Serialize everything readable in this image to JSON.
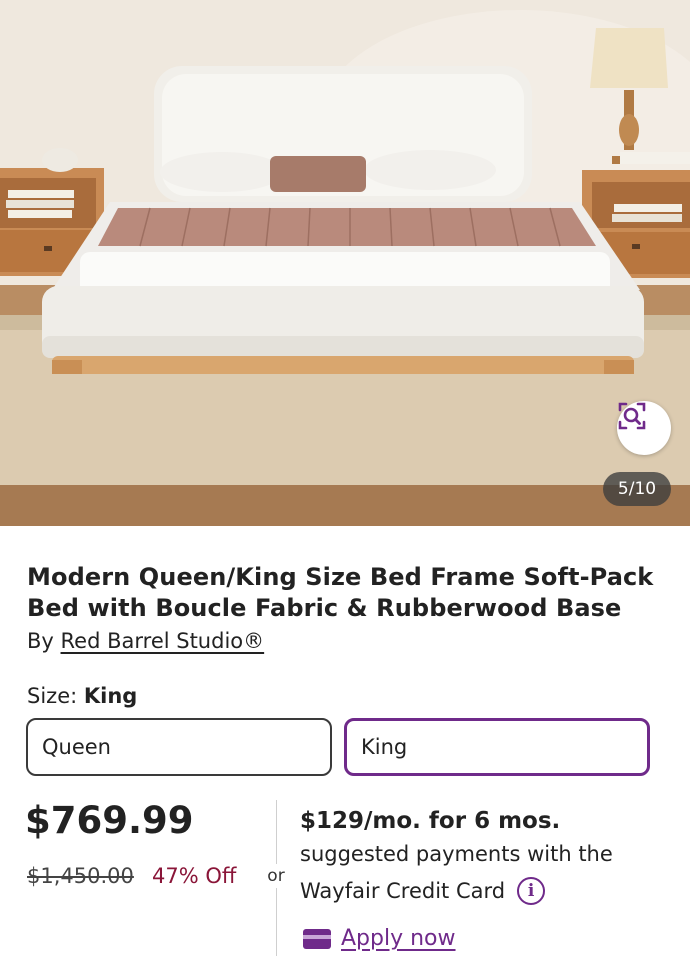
{
  "gallery": {
    "counter": "5/10",
    "zoom_icon": "zoom-search-icon"
  },
  "product": {
    "title": "Modern Queen/King Size Bed Frame Soft-Pack Bed with Boucle Fabric & Rubberwood Base",
    "by_prefix": "By",
    "brand": "Red Barrel Studio®"
  },
  "size": {
    "label": "Size:",
    "selected": "King",
    "options": [
      "Queen",
      "King"
    ]
  },
  "pricing": {
    "price": "$769.99",
    "was_price": "$1,450.00",
    "discount": "47% Off",
    "or": "or"
  },
  "financing": {
    "headline": "$129/mo. for 6 mos.",
    "line1": "suggested payments with the",
    "line2": "Wayfair Credit Card",
    "info_icon": "info-icon",
    "apply_label": "Apply now",
    "card_icon": "credit-card-icon"
  },
  "colors": {
    "accent": "#6f2a8a",
    "discount": "#8a1538"
  }
}
